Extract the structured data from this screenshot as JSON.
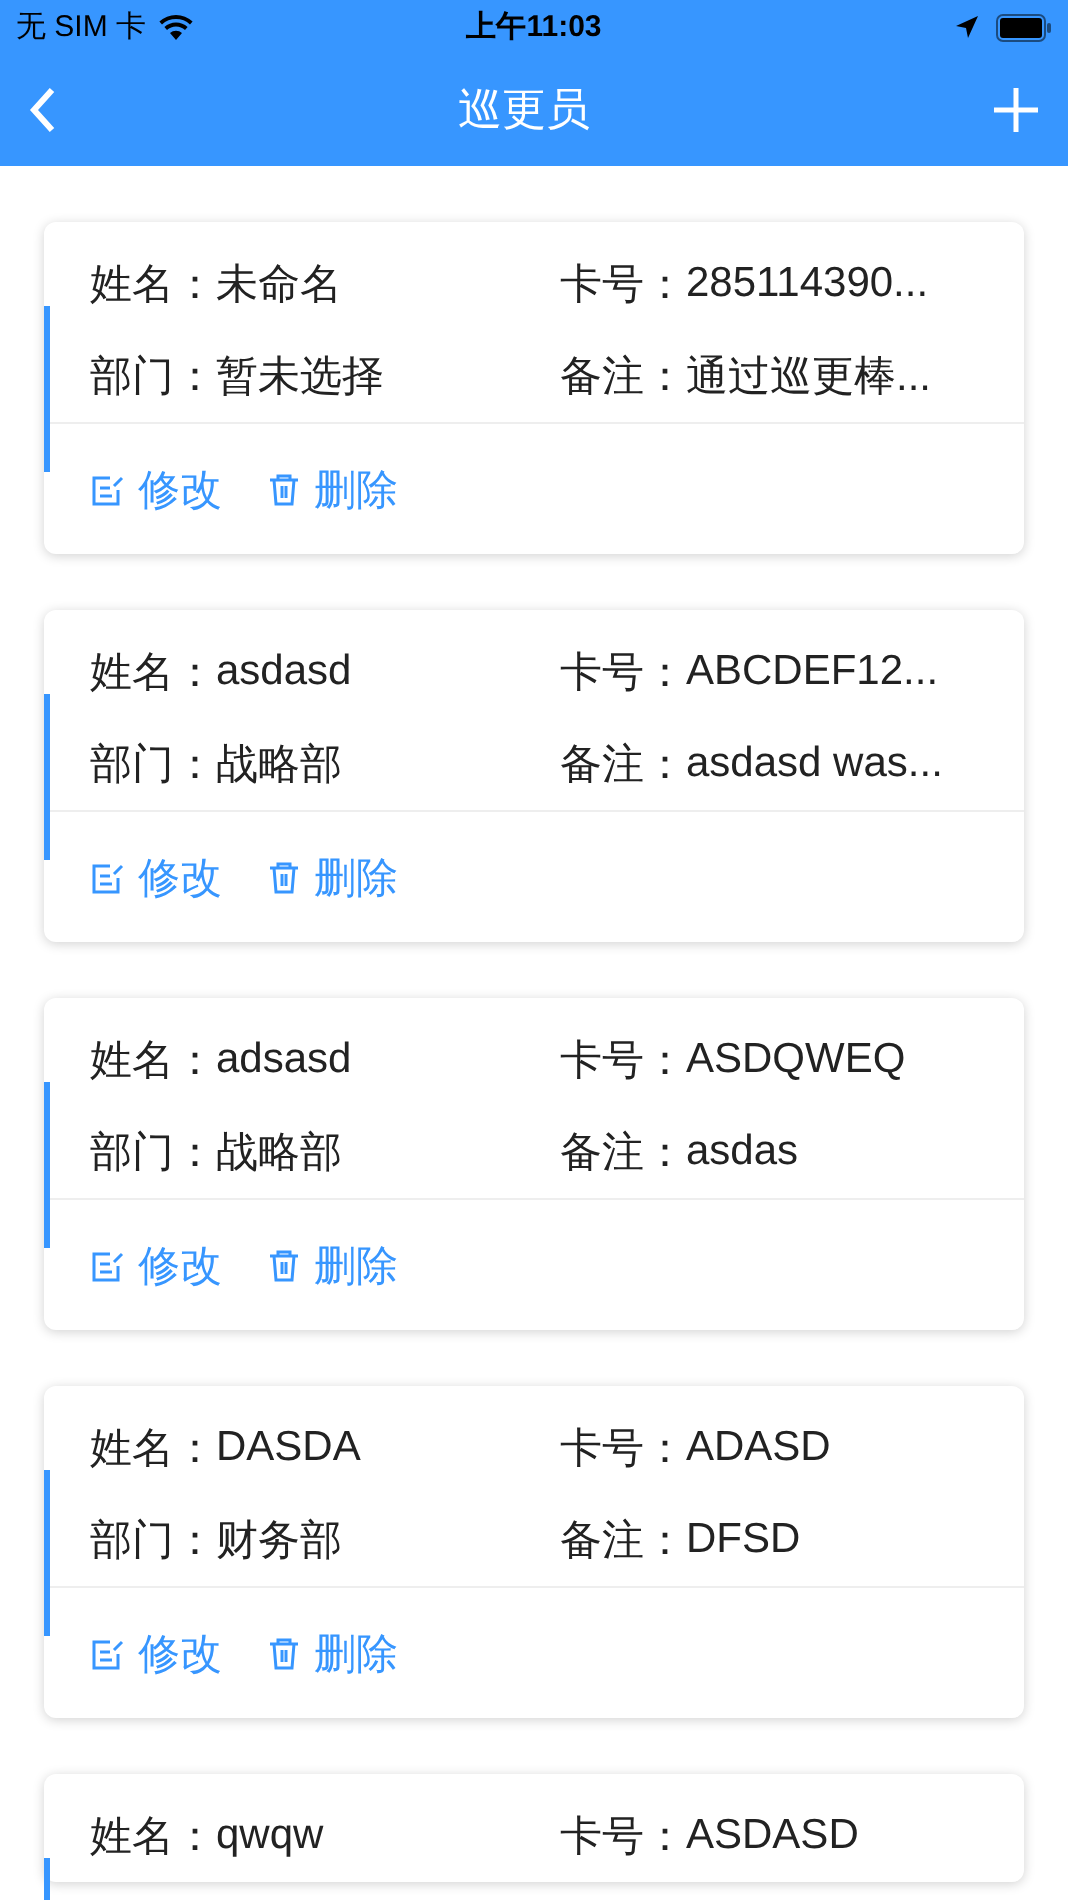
{
  "status_bar": {
    "carrier": "无 SIM 卡",
    "time": "上午11:03"
  },
  "nav": {
    "title": "巡更员"
  },
  "cards": [
    {
      "fields": [
        {
          "label": "姓名：",
          "value": "未命名"
        },
        {
          "label": "卡号：",
          "value": "285114390..."
        },
        {
          "label": "部门：",
          "value": "暂未选择"
        },
        {
          "label": "备注：",
          "value": "通过巡更棒..."
        }
      ],
      "actions": [
        {
          "kind": "edit",
          "label": "修改"
        },
        {
          "kind": "delete",
          "label": "删除"
        }
      ]
    },
    {
      "fields": [
        {
          "label": "姓名：",
          "value": "asdasd"
        },
        {
          "label": "卡号：",
          "value": "ABCDEF12..."
        },
        {
          "label": "部门：",
          "value": "战略部"
        },
        {
          "label": "备注：",
          "value": "asdasd was..."
        }
      ],
      "actions": [
        {
          "kind": "edit",
          "label": "修改"
        },
        {
          "kind": "delete",
          "label": "删除"
        }
      ]
    },
    {
      "fields": [
        {
          "label": "姓名：",
          "value": "adsasd"
        },
        {
          "label": "卡号：",
          "value": "ASDQWEQ"
        },
        {
          "label": "部门：",
          "value": "战略部"
        },
        {
          "label": "备注：",
          "value": "asdas"
        }
      ],
      "actions": [
        {
          "kind": "edit",
          "label": "修改"
        },
        {
          "kind": "delete",
          "label": "删除"
        }
      ]
    },
    {
      "fields": [
        {
          "label": "姓名：",
          "value": "DASDA"
        },
        {
          "label": "卡号：",
          "value": "ADASD"
        },
        {
          "label": "部门：",
          "value": "财务部"
        },
        {
          "label": "备注：",
          "value": "DFSD"
        }
      ],
      "actions": [
        {
          "kind": "edit",
          "label": "修改"
        },
        {
          "kind": "delete",
          "label": "删除"
        }
      ]
    },
    {
      "fields": [
        {
          "label": "姓名：",
          "value": "qwqw"
        },
        {
          "label": "卡号：",
          "value": "ASDASD"
        }
      ]
    }
  ]
}
